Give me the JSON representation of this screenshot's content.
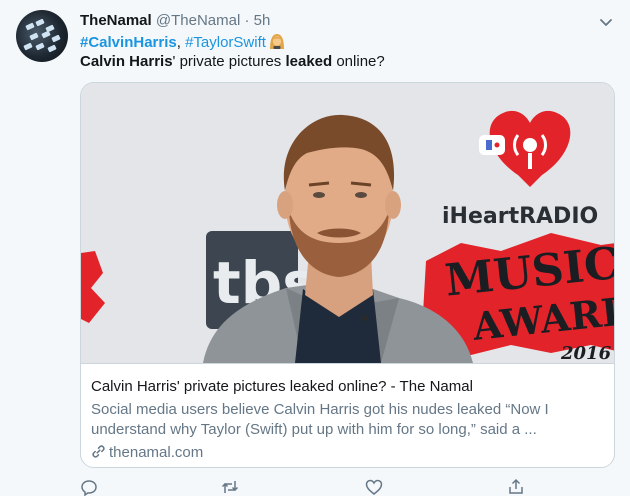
{
  "tweet": {
    "display_name": "TheNamal",
    "handle": "@TheNamal",
    "separator": "·",
    "time": "5h",
    "hashtags": [
      {
        "text": "#CalvinHarris"
      },
      {
        "text": "#TaylorSwift"
      }
    ],
    "hashtag_separator": ", ",
    "text_part1": "Calvin Harris",
    "text_part2": "' private pictures ",
    "text_part3": "leaked",
    "text_part4": " online?"
  },
  "card": {
    "title": "Calvin Harris' private pictures leaked online? - The Namal",
    "description_line1": "Social media users believe Calvin Harris got his nudes leaked “Now I",
    "description_line2": "understand why Taylor (Swift) put up with him for so long,” said a ...",
    "domain": "thenamal.com",
    "image": {
      "backdrop_text_brand": "iHeartRADIO",
      "backdrop_text_music": "MUSIC",
      "backdrop_text_awards": "AWARDS",
      "backdrop_text_year": "2016",
      "backdrop_text_network": "tbs"
    }
  },
  "colors": {
    "accent": "#1b95e0",
    "text": "#14171a",
    "muted": "#657786",
    "border": "#ccd6dd",
    "background": "#f5f8fa",
    "iheart_red": "#e2232a"
  },
  "icons": {
    "caret": "chevron-down-icon",
    "reply": "reply-icon",
    "retweet": "retweet-icon",
    "like": "heart-icon",
    "share": "share-icon",
    "link": "link-icon"
  }
}
